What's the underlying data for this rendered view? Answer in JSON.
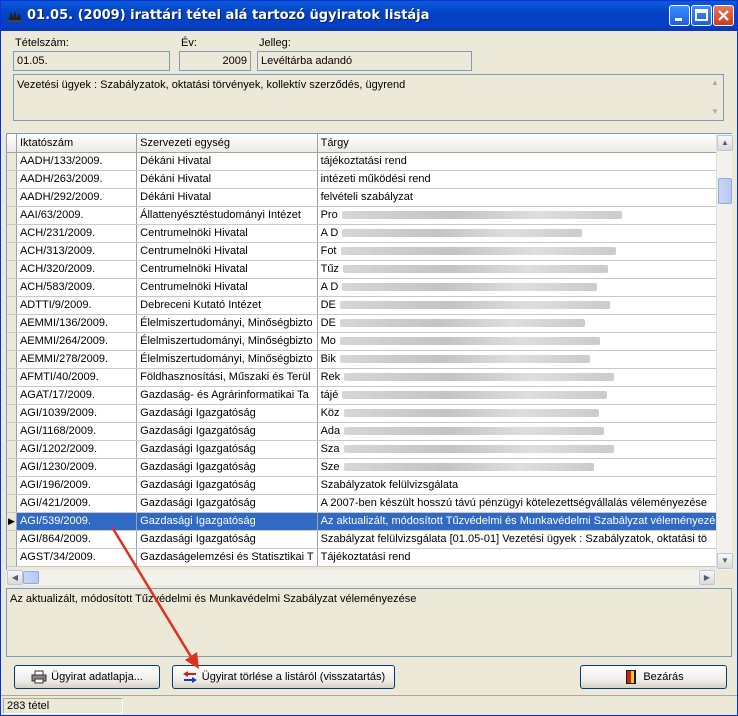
{
  "window": {
    "title": "01.05. (2009) irattári tétel alá tartozó ügyiratok listája"
  },
  "header": {
    "tetelszam_label": "Tételszám:",
    "tetelszam_value": "01.05.",
    "ev_label": "Év:",
    "ev_value": "2009",
    "jelleg_label": "Jelleg:",
    "jelleg_value": "Levéltárba adandó",
    "description": "Vezetési ügyek : Szabályzatok, oktatási törvények, kollektív szerződés, ügyrend"
  },
  "grid": {
    "columns": [
      "Iktatószám",
      "Szervezeti egység",
      "Tárgy"
    ],
    "rows": [
      {
        "iktato": "AADH/133/2009.",
        "egyseg": "Dékáni Hivatal",
        "targy": "tájékoztatási rend"
      },
      {
        "iktato": "AADH/263/2009.",
        "egyseg": "Dékáni Hivatal",
        "targy": "intézeti működési rend"
      },
      {
        "iktato": "AADH/292/2009.",
        "egyseg": "Dékáni Hivatal",
        "targy": "felvételi szabályzat"
      },
      {
        "iktato": "AAI/63/2009.",
        "egyseg": "Állattenyésztéstudományi Intézet",
        "targy": "Pro"
      },
      {
        "iktato": "ACH/231/2009.",
        "egyseg": "Centrumelnöki Hivatal",
        "targy": "A D"
      },
      {
        "iktato": "ACH/313/2009.",
        "egyseg": "Centrumelnöki Hivatal",
        "targy": "Fot"
      },
      {
        "iktato": "ACH/320/2009.",
        "egyseg": "Centrumelnöki Hivatal",
        "targy": "Tűz"
      },
      {
        "iktato": "ACH/583/2009.",
        "egyseg": "Centrumelnöki Hivatal",
        "targy": "A D"
      },
      {
        "iktato": "ADTTI/9/2009.",
        "egyseg": "Debreceni Kutató Intézet",
        "targy": "DE"
      },
      {
        "iktato": "AEMMI/136/2009.",
        "egyseg": "Élelmiszertudományi, Minőségbizto",
        "targy": "DE"
      },
      {
        "iktato": "AEMMI/264/2009.",
        "egyseg": "Élelmiszertudományi, Minőségbizto",
        "targy": "Mo"
      },
      {
        "iktato": "AEMMI/278/2009.",
        "egyseg": "Élelmiszertudományi, Minőségbizto",
        "targy": "Bik"
      },
      {
        "iktato": "AFMTI/40/2009.",
        "egyseg": "Földhasznosítási, Műszaki és Terül",
        "targy": "Rek"
      },
      {
        "iktato": "AGAT/17/2009.",
        "egyseg": "Gazdaság- és Agrárinformatikai Ta",
        "targy": "tájé"
      },
      {
        "iktato": "AGI/1039/2009.",
        "egyseg": "Gazdasági Igazgatóság",
        "targy": "Köz"
      },
      {
        "iktato": "AGI/1168/2009.",
        "egyseg": "Gazdasági Igazgatóság",
        "targy": "Ada"
      },
      {
        "iktato": "AGI/1202/2009.",
        "egyseg": "Gazdasági Igazgatóság",
        "targy": "Sza"
      },
      {
        "iktato": "AGI/1230/2009.",
        "egyseg": "Gazdasági Igazgatóság",
        "targy": "Sze"
      },
      {
        "iktato": "AGI/196/2009.",
        "egyseg": "Gazdasági Igazgatóság",
        "targy": "Szabályzatok felülvizsgálata"
      },
      {
        "iktato": "AGI/421/2009.",
        "egyseg": "Gazdasági Igazgatóság",
        "targy": "A 2007-ben készült hosszú távú pénzügyi kötelezettségvállalás véleményezése"
      },
      {
        "iktato": "AGI/539/2009.",
        "egyseg": "Gazdasági Igazgatóság",
        "targy": "Az aktualizált, módosított Tűzvédelmi és Munkavédelmi Szabályzat véleményezése"
      },
      {
        "iktato": "AGI/864/2009.",
        "egyseg": "Gazdasági Igazgatóság",
        "targy": "Szabályzat felülvizsgálata  [01.05-01] Vezetési ügyek : Szabályzatok, oktatási tö"
      },
      {
        "iktato": "AGST/34/2009.",
        "egyseg": "Gazdaságelemzési és Statisztikai T",
        "targy": "Tájékoztatási rend"
      }
    ],
    "selected_index": 20,
    "blurred_indices": [
      3,
      4,
      5,
      6,
      7,
      8,
      9,
      10,
      11,
      12,
      13,
      14,
      15,
      16,
      17
    ]
  },
  "detail": {
    "text": "Az aktualizált, módosított Tűzvédelmi és Munkavédelmi Szabályzat véleményezése"
  },
  "buttons": {
    "adatlap": "Ügyirat adatlapja...",
    "torles": "Ügyirat törlése a listáról (visszatartás)",
    "bezaras": "Bezárás"
  },
  "status": {
    "count": "283 tétel"
  },
  "colors": {
    "selection": "#316ac5",
    "annotation_arrow": "#e03020"
  }
}
